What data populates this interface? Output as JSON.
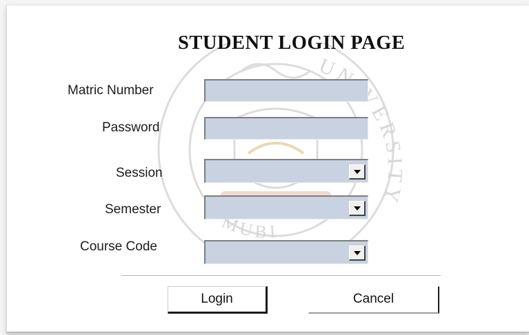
{
  "form": {
    "title": "STUDENT LOGIN PAGE",
    "fields": {
      "matric_number": {
        "label": "Matric Number",
        "value": "",
        "placeholder": ""
      },
      "password": {
        "label": "Password",
        "value": "",
        "placeholder": ""
      },
      "session": {
        "label": "Session",
        "selected": ""
      },
      "semester": {
        "label": "Semester",
        "selected": ""
      },
      "course_code": {
        "label": "Course Code",
        "selected": ""
      }
    },
    "buttons": {
      "login": "Login",
      "cancel": "Cancel"
    },
    "watermark_text": {
      "right": "UNIVERSITY",
      "bottom": "MUBI"
    }
  },
  "colors": {
    "field_bg": "#c8d2e0",
    "watermark": "#d9d9d9",
    "watermark_accent": "#e9c6b8"
  },
  "icons": {
    "dropdown": "chevron-down-icon"
  }
}
